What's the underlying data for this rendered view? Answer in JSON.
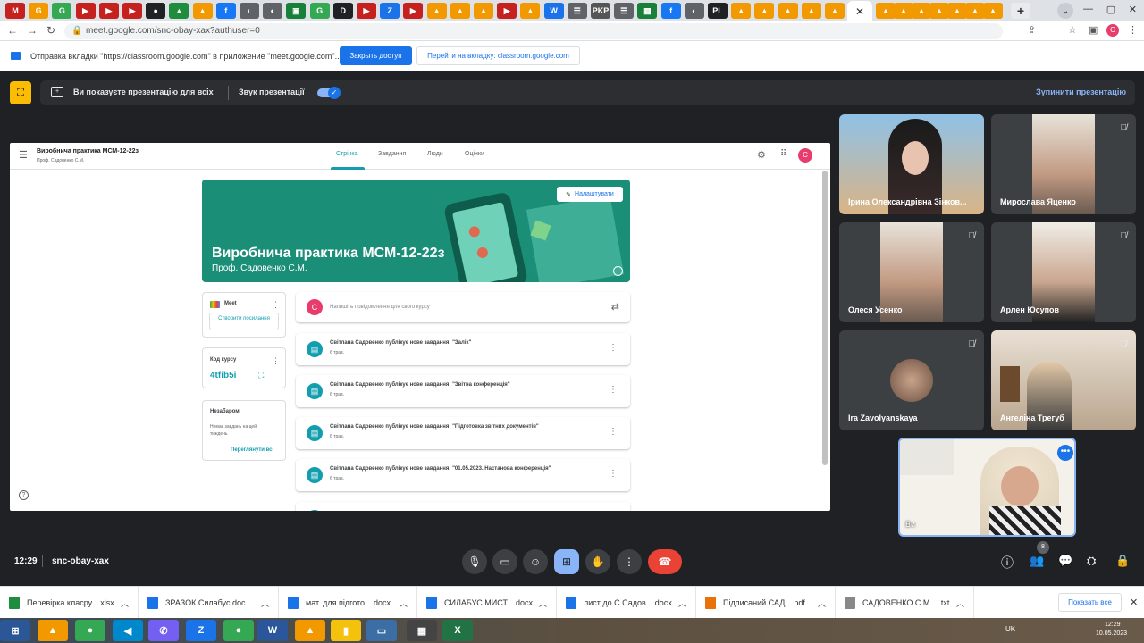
{
  "browser": {
    "url": "meet.google.com/snc-obay-xax?authuser=0",
    "active_tab_close": "✕",
    "new_tab": "+",
    "profile_initial": "C",
    "infobar": {
      "message": "Отправка вкладки \"https://classroom.google.com\" в приложение \"meet.google.com\"...",
      "stop_button": "Закрыть доступ",
      "goto_button": "Перейти на вкладку: classroom.google.com"
    },
    "tab_icons": [
      "M",
      "G",
      "G",
      "▶",
      "▶",
      "▶",
      "●",
      "▲",
      "▲",
      "f",
      "◐",
      "◐",
      "▣",
      "G",
      "D",
      "▶",
      "Z",
      "▶",
      "▲",
      "▲",
      "▲",
      "▶",
      "▲",
      "W",
      "☰",
      "PKP",
      "☰",
      "▦",
      "f",
      "◐",
      "PL",
      "▲",
      "▲",
      "▲",
      "▲",
      "▲",
      "▲",
      "▲",
      "▲",
      "▲",
      "▲",
      "▲",
      "▲"
    ]
  },
  "presenting": {
    "message": "Ви показуєте презентацію для всіх",
    "sound_label": "Звук презентації",
    "stop_label": "Зупинити презентацію",
    "sound_enabled": true
  },
  "classroom": {
    "course_name": "Виробнича практика МСМ-12-22з",
    "teacher_short": "Проф. Садовенко С.М.",
    "tabs": [
      "Стрічка",
      "Завдання",
      "Люди",
      "Оцінки"
    ],
    "active_tab": "Стрічка",
    "avatar_initial": "C",
    "banner_title": "Виробнича практика МСМ-12-22з",
    "banner_subtitle": "Проф. Садовенко С.М.",
    "customize_button": "Налаштувати",
    "meet_label": "Meet",
    "create_link": "Створити посилання",
    "course_code_label": "Код курсу",
    "course_code": "4tfib5i",
    "upcoming_label": "Незабаром",
    "upcoming_text": "Немає завдань на цей тиждень",
    "view_all": "Переглянути всі",
    "compose_placeholder": "Напишіть повідомлення для свого курсу",
    "posts": [
      {
        "title": "Світлана Садовенко публікує нове завдання: \"Залік\"",
        "date": "6 трав."
      },
      {
        "title": "Світлана Садовенко публікує нове завдання: \"Звітна конференція\"",
        "date": "6 трав."
      },
      {
        "title": "Світлана Садовенко публікує нове завдання: \"Підготовка звітних документів\"",
        "date": "6 трав."
      },
      {
        "title": "Світлана Садовенко публікує нове завдання: \"01.05.2023. Настанова конференція\"",
        "date": "6 трав."
      }
    ]
  },
  "participants": [
    {
      "name": "Ірина Олександрівна Зінков...",
      "muted": false
    },
    {
      "name": "Мирослава Яценко",
      "muted": true
    },
    {
      "name": "Олеся Усенко",
      "muted": true
    },
    {
      "name": "Арлен Юсупов",
      "muted": true
    },
    {
      "name": "Ira Zavolyanskaya",
      "muted": true
    },
    {
      "name": "Ангеліна Трегуб",
      "muted": true
    }
  ],
  "self_tile": {
    "name": "Ви"
  },
  "meeting": {
    "time": "12:29",
    "code": "snc-obay-xax",
    "participant_count": "8"
  },
  "downloads": {
    "items": [
      "Перевірка класру....xlsx",
      "ЗРАЗОК Силабус.doc",
      "мат. для підгото....docx",
      "СИЛАБУС МИСТ....docx",
      "лист до С.Садов....docx",
      "Підписаний САД....pdf",
      "САДОВЕНКО С.М.....txt"
    ],
    "show_all": "Показать все"
  },
  "taskbar": {
    "lang": "UK",
    "time": "12:29",
    "date": "10.05.2023",
    "apps": [
      "⊞",
      "▲",
      "●",
      "◀",
      "✆",
      "Z",
      "●",
      "W",
      "▲",
      "▮",
      "▭",
      "▦",
      "X"
    ]
  },
  "colors": {
    "accent": "#1a73e8",
    "meet_bg": "#202124",
    "end_call": "#ea4335",
    "classroom_teal": "#129eaf",
    "present_blue": "#8ab4f8"
  }
}
